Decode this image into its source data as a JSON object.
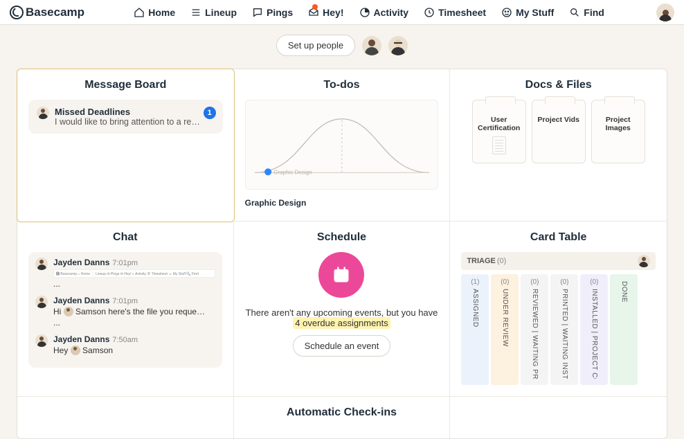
{
  "brand": "Basecamp",
  "nav": {
    "home": "Home",
    "lineup": "Lineup",
    "pings": "Pings",
    "hey": "Hey!",
    "activity": "Activity",
    "timesheet": "Timesheet",
    "mystuff": "My Stuff",
    "find": "Find"
  },
  "people": {
    "setup_label": "Set up people"
  },
  "cards": {
    "message_board": {
      "title": "Message Board",
      "item": {
        "title": "Missed Deadlines",
        "body": "I would like to bring attention to a recurring",
        "badge": "1"
      }
    },
    "todos": {
      "title": "To-dos",
      "hill_label": "Graphic Design",
      "list_name": "Graphic Design"
    },
    "docs": {
      "title": "Docs & Files",
      "folders": [
        "User Certification",
        "Project Vids",
        "Project Images"
      ]
    },
    "chat": {
      "title": "Chat",
      "msgs": [
        {
          "author": "Jayden Danns",
          "time": "7:01pm",
          "body": "...",
          "screenshot": true
        },
        {
          "author": "Jayden Danns",
          "time": "7:01pm",
          "body": "Hi 👤 Samson here's the file you requested ..."
        },
        {
          "author": "Jayden Danns",
          "time": "7:50am",
          "body": "Hey 👤 Samson"
        }
      ],
      "nav_thumb": "🅱 Basecamp   ⌂ Home   ⋮ Lineup   ✉ Pings   ✉ Hey!   ◐ Activity   ⊕ Timesheet   ☺ My Stuff   🔍 Find"
    },
    "schedule": {
      "title": "Schedule",
      "text_a": "There aren't any upcoming events, but you have ",
      "text_hl": "4 overdue assignments",
      "button": "Schedule an event"
    },
    "cardtable": {
      "title": "Card Table",
      "triage_label": "TRIAGE",
      "triage_count": "(0)",
      "columns": [
        {
          "count": "(1)",
          "name": "ASSIGNED",
          "cls": "c-blue"
        },
        {
          "count": "(0)",
          "name": "UNDER REVIEW",
          "cls": "c-peach"
        },
        {
          "count": "(0)",
          "name": "REVIEWED | WAITING PRI",
          "cls": "c-gray"
        },
        {
          "count": "(0)",
          "name": "PRINTED | WAITING INSTA",
          "cls": "c-gray"
        },
        {
          "count": "(0)",
          "name": "INSTALLED | PROJECT CO",
          "cls": "c-lav"
        },
        {
          "count": "",
          "name": "DONE",
          "cls": "c-green"
        }
      ]
    },
    "checkins": {
      "title": "Automatic Check-ins"
    }
  }
}
